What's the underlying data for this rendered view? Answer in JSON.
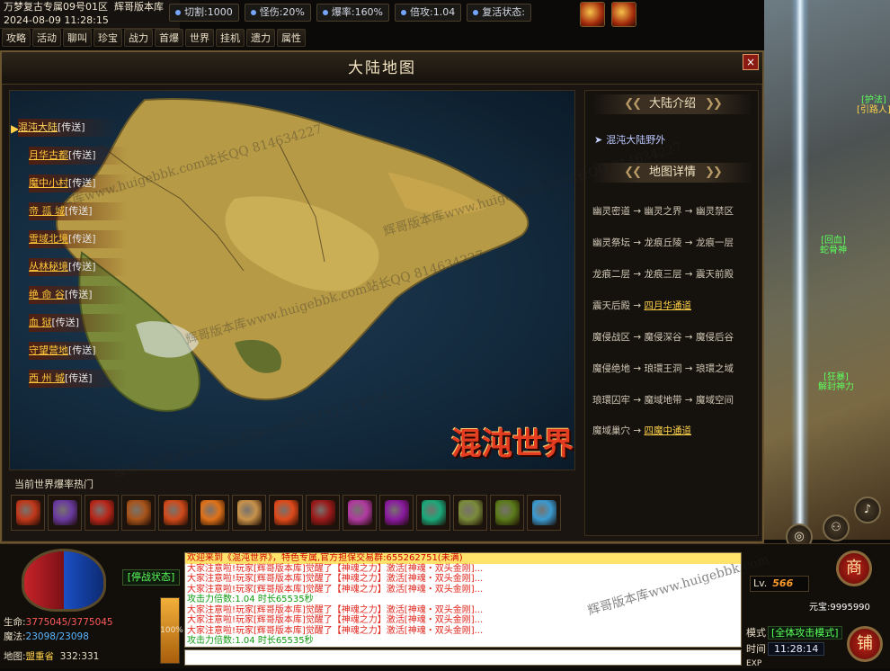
{
  "top": {
    "server": "万梦复古专属09号01区",
    "brand": "辉哥版本库",
    "datetime": "2024-08-09 11:28:15"
  },
  "stats": [
    {
      "label": "切割:1000"
    },
    {
      "label": "怪伤:20%"
    },
    {
      "label": "爆率:160%"
    },
    {
      "label": "倍攻:1.04"
    },
    {
      "label": "复活状态:"
    }
  ],
  "menu": [
    "攻略",
    "活动",
    "聊叫",
    "珍宝",
    "战力",
    "首爆",
    "世界",
    "挂机",
    "遗力",
    "属性"
  ],
  "npcs": [
    {
      "tag": "[护法]",
      "name": "[引路人]"
    },
    {
      "tag": "[回血]",
      "name": "蛇骨神"
    },
    {
      "tag": "[狂暴]",
      "name": "解封神力"
    }
  ],
  "panel": {
    "title": "大陆地图",
    "close": "×",
    "locations": [
      {
        "name": "混沌大陆",
        "tag": "[传送]"
      },
      {
        "name": "月华古都",
        "tag": "[传送]"
      },
      {
        "name": "魔中小村",
        "tag": "[传送]"
      },
      {
        "name": "帝 孤 城",
        "tag": "[传送]"
      },
      {
        "name": "雪域北境",
        "tag": "[传送]"
      },
      {
        "name": "丛林秘境",
        "tag": "[传送]"
      },
      {
        "name": "绝 命 谷",
        "tag": "[传送]"
      },
      {
        "name": "血 狱",
        "tag": "[传送]"
      },
      {
        "name": "守望营地",
        "tag": "[传送]"
      },
      {
        "name": "西 州 城",
        "tag": "[传送]"
      }
    ],
    "logo": "混沌世界",
    "intro_title": "大陆介绍",
    "intro_item": "混沌大陆野外",
    "detail_title": "地图详情",
    "paths": [
      {
        "text": "幽灵密道 → 幽灵之界 → 幽灵禁区",
        "link": ""
      },
      {
        "text": "幽灵祭坛 → 龙痕丘陵 → 龙痕一层",
        "link": ""
      },
      {
        "text": "龙痕二层 → 龙痕三层 → 震天前殿",
        "link": ""
      },
      {
        "text": "震天后殿 → ",
        "link": "四月华通道"
      },
      {
        "text": "魔侵战区 → 魔侵深谷 → 魔侵后谷",
        "link": ""
      },
      {
        "text": "魔侵绝地 → 琅環王洞 → 琅環之域",
        "link": ""
      },
      {
        "text": "琅環囚牢 → 魔域地带 → 魔域空间",
        "link": ""
      },
      {
        "text": "魔域巢穴 → ",
        "link": "四魔中通道"
      }
    ],
    "hot_label": "当前世界爆率热门",
    "hot_items": [
      {
        "icon": "armor-icon",
        "color": "#c0381a"
      },
      {
        "icon": "orb-icon",
        "color": "#6a3aa0"
      },
      {
        "icon": "ring-icon",
        "color": "#b8261a"
      },
      {
        "icon": "helmet-icon",
        "color": "#a8541a"
      },
      {
        "icon": "mask-icon",
        "color": "#d04a1a"
      },
      {
        "icon": "sword-icon",
        "color": "#e0721a"
      },
      {
        "icon": "scroll-icon",
        "color": "#c8924a"
      },
      {
        "icon": "blade-icon",
        "color": "#e04a1a"
      },
      {
        "icon": "dagger-icon",
        "color": "#9a1a1a"
      },
      {
        "icon": "wings-icon",
        "color": "#b03aa0"
      },
      {
        "icon": "beast-icon",
        "color": "#8a1aa0"
      },
      {
        "icon": "gem-icon",
        "color": "#1aa87a"
      },
      {
        "icon": "amulet-icon",
        "color": "#7a8a3a"
      },
      {
        "icon": "horn-icon",
        "color": "#5a7a1a"
      },
      {
        "icon": "crystal-icon",
        "color": "#3a9ad0"
      }
    ]
  },
  "bottom": {
    "battle_state": "[停战状态]",
    "hp_label": "生命:",
    "hp_value": "3775045/3775045",
    "mp_label": "魔法:",
    "mp_value": "23098/23098",
    "map_label": "地图:",
    "map_name": "盟重省",
    "map_coords": "332:331",
    "exp_percent": "100%",
    "exp_fraction": 1.0,
    "level_label": "Lv.",
    "level_value": "566",
    "gold_label": "元宝:",
    "gold_value": "9995990",
    "mode_label": "模式",
    "mode_value": "[全体攻击模式]",
    "time_label": "时间",
    "time_value": "11:28:14",
    "exp_label": "EXP",
    "btn_shop": "商",
    "btn_store": "铺"
  },
  "chat": [
    {
      "style": "c-hl",
      "text": "欢迎来到《混沌世界》，特色专属,官方担保交易群:655262751(未满)"
    },
    {
      "style": "c-red",
      "text": "大家注意啦!玩家[辉哥版本库]觉醒了【神魂之力】激活[神魂・双头金刚]..."
    },
    {
      "style": "c-red",
      "text": "大家注意啦!玩家[辉哥版本库]觉醒了【神魂之力】激活[神魂・双头金刚]..."
    },
    {
      "style": "c-red",
      "text": "大家注意啦!玩家[辉哥版本库]觉醒了【神魂之力】激活[神魂・双头金刚]..."
    },
    {
      "style": "c-green",
      "text": "攻击力倍数:1.04 时长65535秒"
    },
    {
      "style": "c-red",
      "text": "大家注意啦!玩家[辉哥版本库]觉醒了【神魂之力】激活[神魂・双头金刚]..."
    },
    {
      "style": "c-red",
      "text": "大家注意啦!玩家[辉哥版本库]觉醒了【神魂之力】激活[神魂・双头金刚]..."
    },
    {
      "style": "c-red",
      "text": "大家注意啦!玩家[辉哥版本库]觉醒了【神魂之力】激活[神魂・双头金刚]..."
    },
    {
      "style": "c-green",
      "text": "攻击力倍数:1.04 时长65535秒"
    }
  ],
  "watermarks": [
    "辉哥版本库www.huigebbk.com站长QQ 814634227",
    "辉哥版本库www.huigebbk.com站长QQ 814634227",
    "辉哥版本库www.huigebbk.com站长QQ 814634227",
    "辉哥版本库www.huigebbk.com站长QQ 814634227",
    "辉哥版本库www.huigebbk.com"
  ]
}
